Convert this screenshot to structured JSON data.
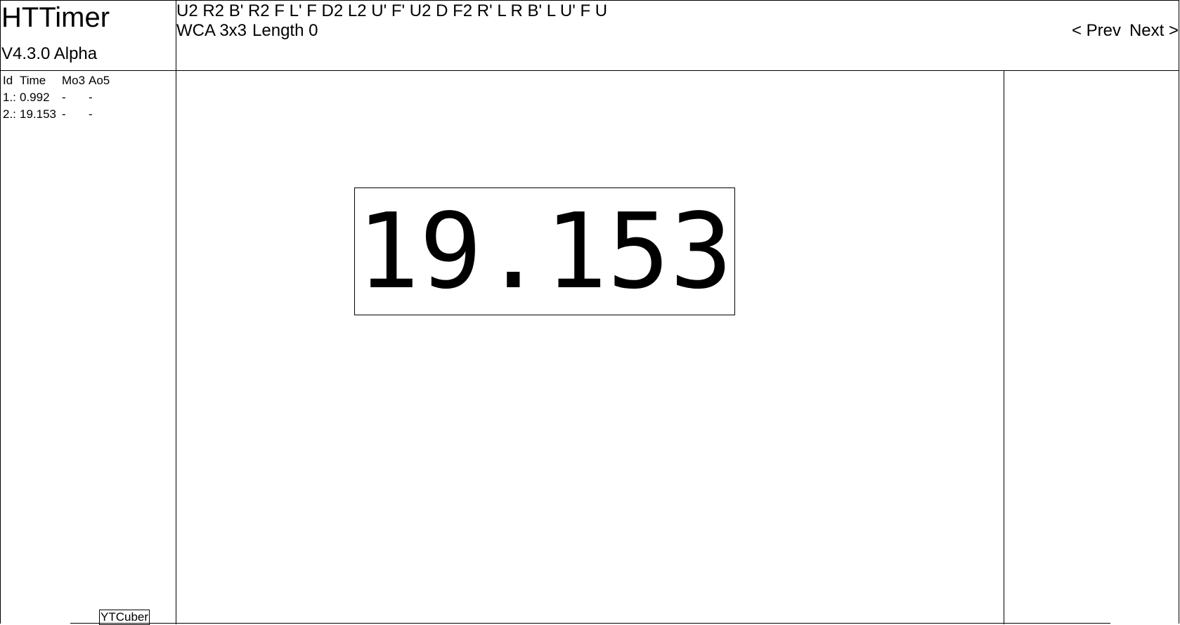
{
  "header": {
    "app_title": "HTTimer",
    "app_version": "V4.3.0 Alpha"
  },
  "scramble": {
    "moves": "U2 R2 B' R2 F L' F D2 L2 U' F' U2 D F2 R' L R B' L U' F U",
    "puzzle": "WCA 3x3",
    "length_label": "Length 0"
  },
  "nav": {
    "prev_label": "< Prev",
    "next_label": "Next >"
  },
  "session": {
    "columns": [
      "Id",
      "Time",
      "Mo3",
      "Ao5"
    ],
    "rows": [
      {
        "id": "1.:",
        "time": "0.992",
        "mo3": "-",
        "ao5": "-"
      },
      {
        "id": "2.:",
        "time": "19.153",
        "mo3": "-",
        "ao5": "-"
      }
    ]
  },
  "timer": {
    "value": "19.153"
  },
  "footer": {
    "ytcuber_label": "YTCuber"
  }
}
